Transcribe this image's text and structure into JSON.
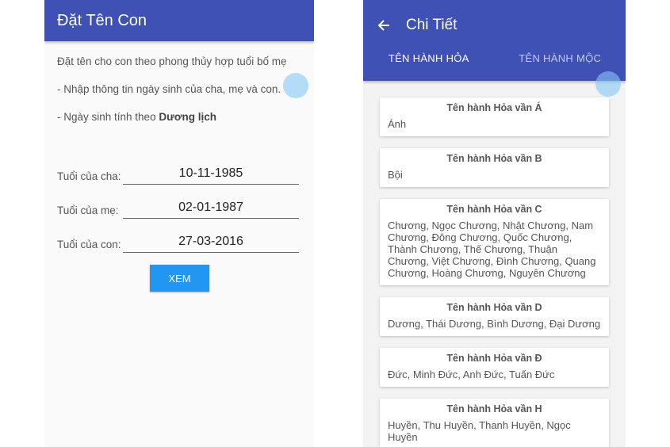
{
  "left_screen": {
    "app_title": "Đặt Tên Con",
    "intro_line1": "Đặt tên cho con theo phong thủy hợp tuổi bố mẹ",
    "intro_line2": "- Nhập thông tin ngày sinh của cha, mẹ và con.",
    "intro_line3_prefix": "- Ngày sinh tính theo ",
    "intro_line3_bold": "Dương lịch",
    "fields": [
      {
        "label": "Tuổi của cha:",
        "value": "10-11-1985"
      },
      {
        "label": "Tuổi của mẹ:",
        "value": "02-01-1987"
      },
      {
        "label": "Tuổi của con:",
        "value": "27-03-2016"
      }
    ],
    "submit_label": "XEM"
  },
  "right_screen": {
    "title": "Chi Tiết",
    "back_icon": "arrow-left-icon",
    "tabs": [
      {
        "label": "TÊN HÀNH HỎA",
        "active": true
      },
      {
        "label": "TÊN HÀNH MỘC",
        "active": false
      }
    ],
    "cards": [
      {
        "title": "Tên hành Hỏa vần Á",
        "names": "Ánh"
      },
      {
        "title": "Tên hành Hỏa vần B",
        "names": "Bội"
      },
      {
        "title": "Tên hành Hỏa vần C",
        "names": "Chương, Ngọc Chương, Nhật Chương, Nam Chương, Đông Chương, Quốc Chương, Thành Chương, Thế Chương, Thuận Chương, Việt Chương, Đình Chương, Quang Chương, Hoàng Chương, Nguyên Chương"
      },
      {
        "title": "Tên hành Hỏa vần D",
        "names": "Dương, Thái Dương, Bình Dương, Đại Dương"
      },
      {
        "title": "Tên hành Hỏa vần Đ",
        "names": "Đức, Minh Đức, Anh Đức, Tuấn Đức"
      },
      {
        "title": "Tên hành Hỏa vần H",
        "names": "Huyền, Thu Huyền, Thanh Huyền, Ngọc Huyền"
      }
    ]
  },
  "colors": {
    "primary": "#3f51b5",
    "button": "#2196f3",
    "touch_indicator": "#87c8f5"
  }
}
